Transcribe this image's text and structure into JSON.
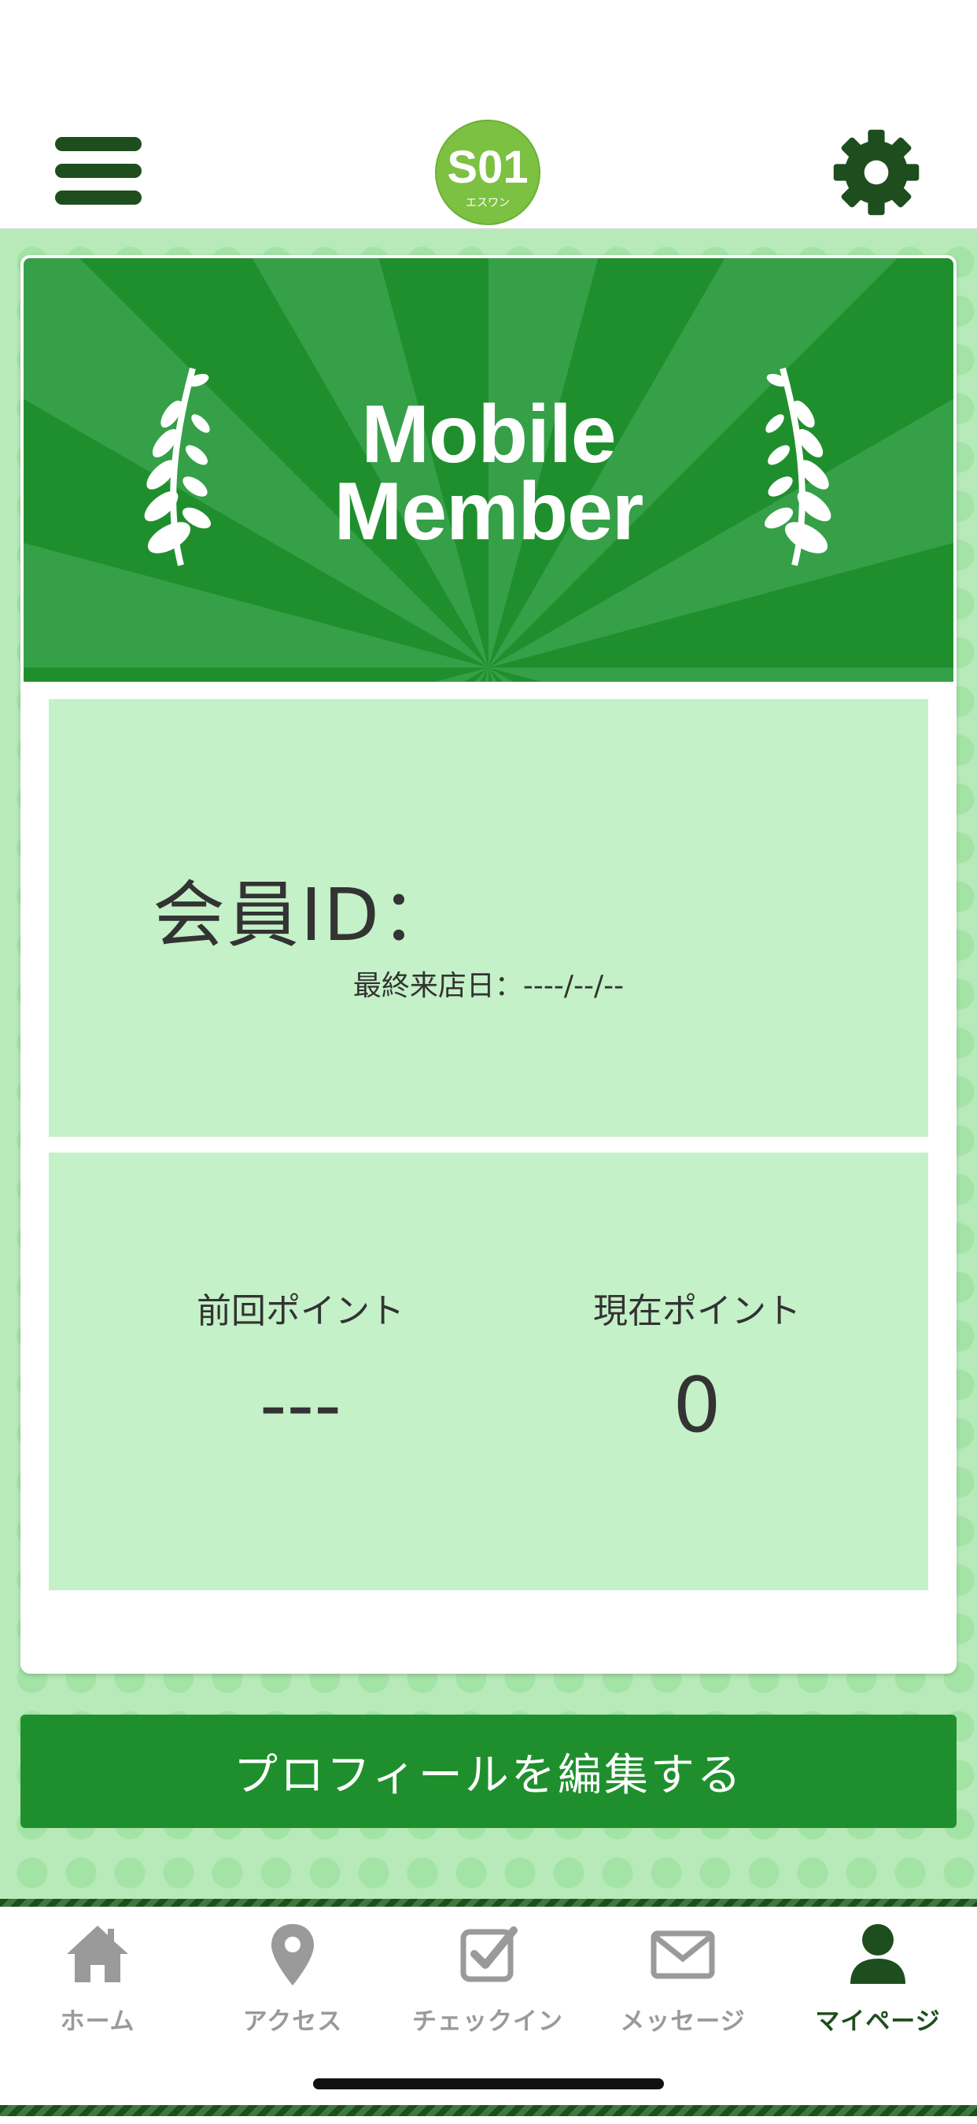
{
  "header": {
    "logo_text": "S01",
    "logo_sub": "エスワン"
  },
  "banner": {
    "title_line1": "Mobile",
    "title_line2": "Member"
  },
  "member": {
    "id_label": "会員ID：",
    "last_visit": "最終来店日：----/--/--"
  },
  "points": {
    "previous_label": "前回ポイント",
    "previous_value": "---",
    "current_label": "現在ポイント",
    "current_value": "0"
  },
  "edit_button_label": "プロフィールを編集する",
  "tabs": [
    {
      "label": "ホーム",
      "icon": "home-icon",
      "active": false
    },
    {
      "label": "アクセス",
      "icon": "map-pin-icon",
      "active": false
    },
    {
      "label": "チェックイン",
      "icon": "checkbox-icon",
      "active": false
    },
    {
      "label": "メッセージ",
      "icon": "envelope-icon",
      "active": false
    },
    {
      "label": "マイページ",
      "icon": "user-icon",
      "active": true
    }
  ],
  "colors": {
    "brand_green": "#1f8f2e",
    "dark_green": "#1e4d1e",
    "panel_green": "#c4f1c8",
    "inactive_gray": "#9a9a9a"
  }
}
